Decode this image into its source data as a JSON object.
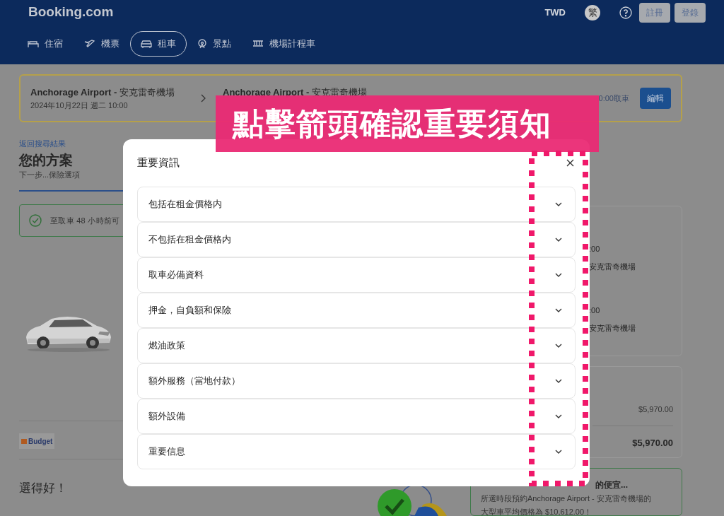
{
  "header": {
    "logo": "Booking.com",
    "currency": "TWD",
    "language": "繁",
    "buttons": [
      "註冊",
      "登錄"
    ],
    "nav": [
      {
        "label": "住宿",
        "kind": "bed",
        "selected": false
      },
      {
        "label": "機票",
        "kind": "plane",
        "selected": false
      },
      {
        "label": "租車",
        "kind": "car",
        "selected": true
      },
      {
        "label": "景點",
        "kind": "attraction",
        "selected": false
      },
      {
        "label": "機場計程車",
        "kind": "taxi",
        "selected": false
      }
    ]
  },
  "search_summary": {
    "pickup": {
      "location": "**Anchorage Airport -** 安克雷奇機場",
      "datetime": "2024年10月22日 週二 10:00"
    },
    "dropoff": {
      "location": "**Anchorage Airport -** 安克雷奇機場"
    },
    "notice": "0:00取車",
    "edit_button": "編輯"
  },
  "plan": {
    "back_link": "返回搜尋結果",
    "title": "您的方案",
    "next_step": "下一步...保險選項",
    "cancellation_notice": "至取車 48 小時前可",
    "supplier": "Budget",
    "heading": "選得好！"
  },
  "side": {
    "pickup_time": ":00",
    "pickup_location": "安克雷奇機場",
    "dropoff_time": ":00",
    "dropoff_location": "安克雷奇機場",
    "price": "$5,970.00",
    "total": "$5,970.00",
    "deal_heading": "的便宜...",
    "deal_lines": [
      "所選時段預約Anchorage Airport - 安克雷奇機場的",
      "大型車平均價格為 $10,612.00！"
    ]
  },
  "modal": {
    "title": "重要資訊",
    "sections": [
      {
        "label": "包括在租金價格内",
        "expanded": false
      },
      {
        "label": "不包括在租金價格内",
        "expanded": false
      },
      {
        "label": "取車必備資料",
        "expanded": false
      },
      {
        "label": "押金，自負額和保險",
        "expanded": false
      },
      {
        "label": "燃油政策",
        "expanded": false
      },
      {
        "label": "額外服務（當地付款）",
        "expanded": false
      },
      {
        "label": "額外設備",
        "expanded": false
      },
      {
        "label": "重要信息",
        "expanded": false
      }
    ]
  },
  "callout": {
    "text": "點擊箭頭確認重要須知"
  }
}
